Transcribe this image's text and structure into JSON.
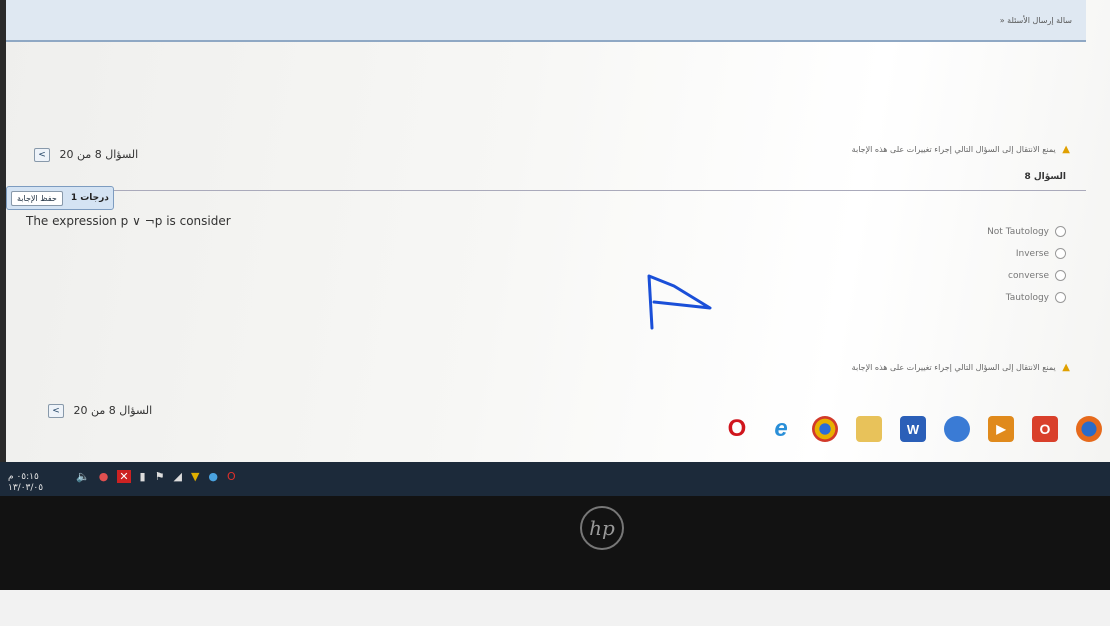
{
  "top_panel": {
    "text": "» سالة إرسال الأسئلة"
  },
  "nav_top": {
    "label": "السؤال 8 من 20",
    "next": "<"
  },
  "nav_bottom": {
    "label": "السؤال 8 من 20",
    "next": "<"
  },
  "warning_top": "يمنع الانتقال إلى السؤال التالي إجراء تغييرات على هذه الإجابة",
  "warning_bottom": "يمنع الانتقال إلى السؤال التالي إجراء تغييرات على هذه الإجابة",
  "question": {
    "title": "السؤال 8",
    "grade": "1 درجات",
    "save_label": "حفظ الإجابة",
    "text": "The expression p ∨ ¬p is consider",
    "options": [
      "Not Tautology",
      "Inverse",
      "converse",
      "Tautology"
    ]
  },
  "taskbar": {
    "icons": [
      "opera-icon",
      "ie-icon",
      "chrome-icon",
      "explorer-icon",
      "word-icon",
      "messenger-icon",
      "media-icon",
      "office-icon",
      "firefox-icon"
    ],
    "clock_time": "٠٥:١٥ م",
    "clock_date": "١٣/٠٣/٠٥"
  },
  "bezel": {
    "logo": "hp"
  },
  "colors": {
    "accent": "#2b6cb0",
    "annotation": "#1a4fd8",
    "warning": "#e0a000"
  }
}
